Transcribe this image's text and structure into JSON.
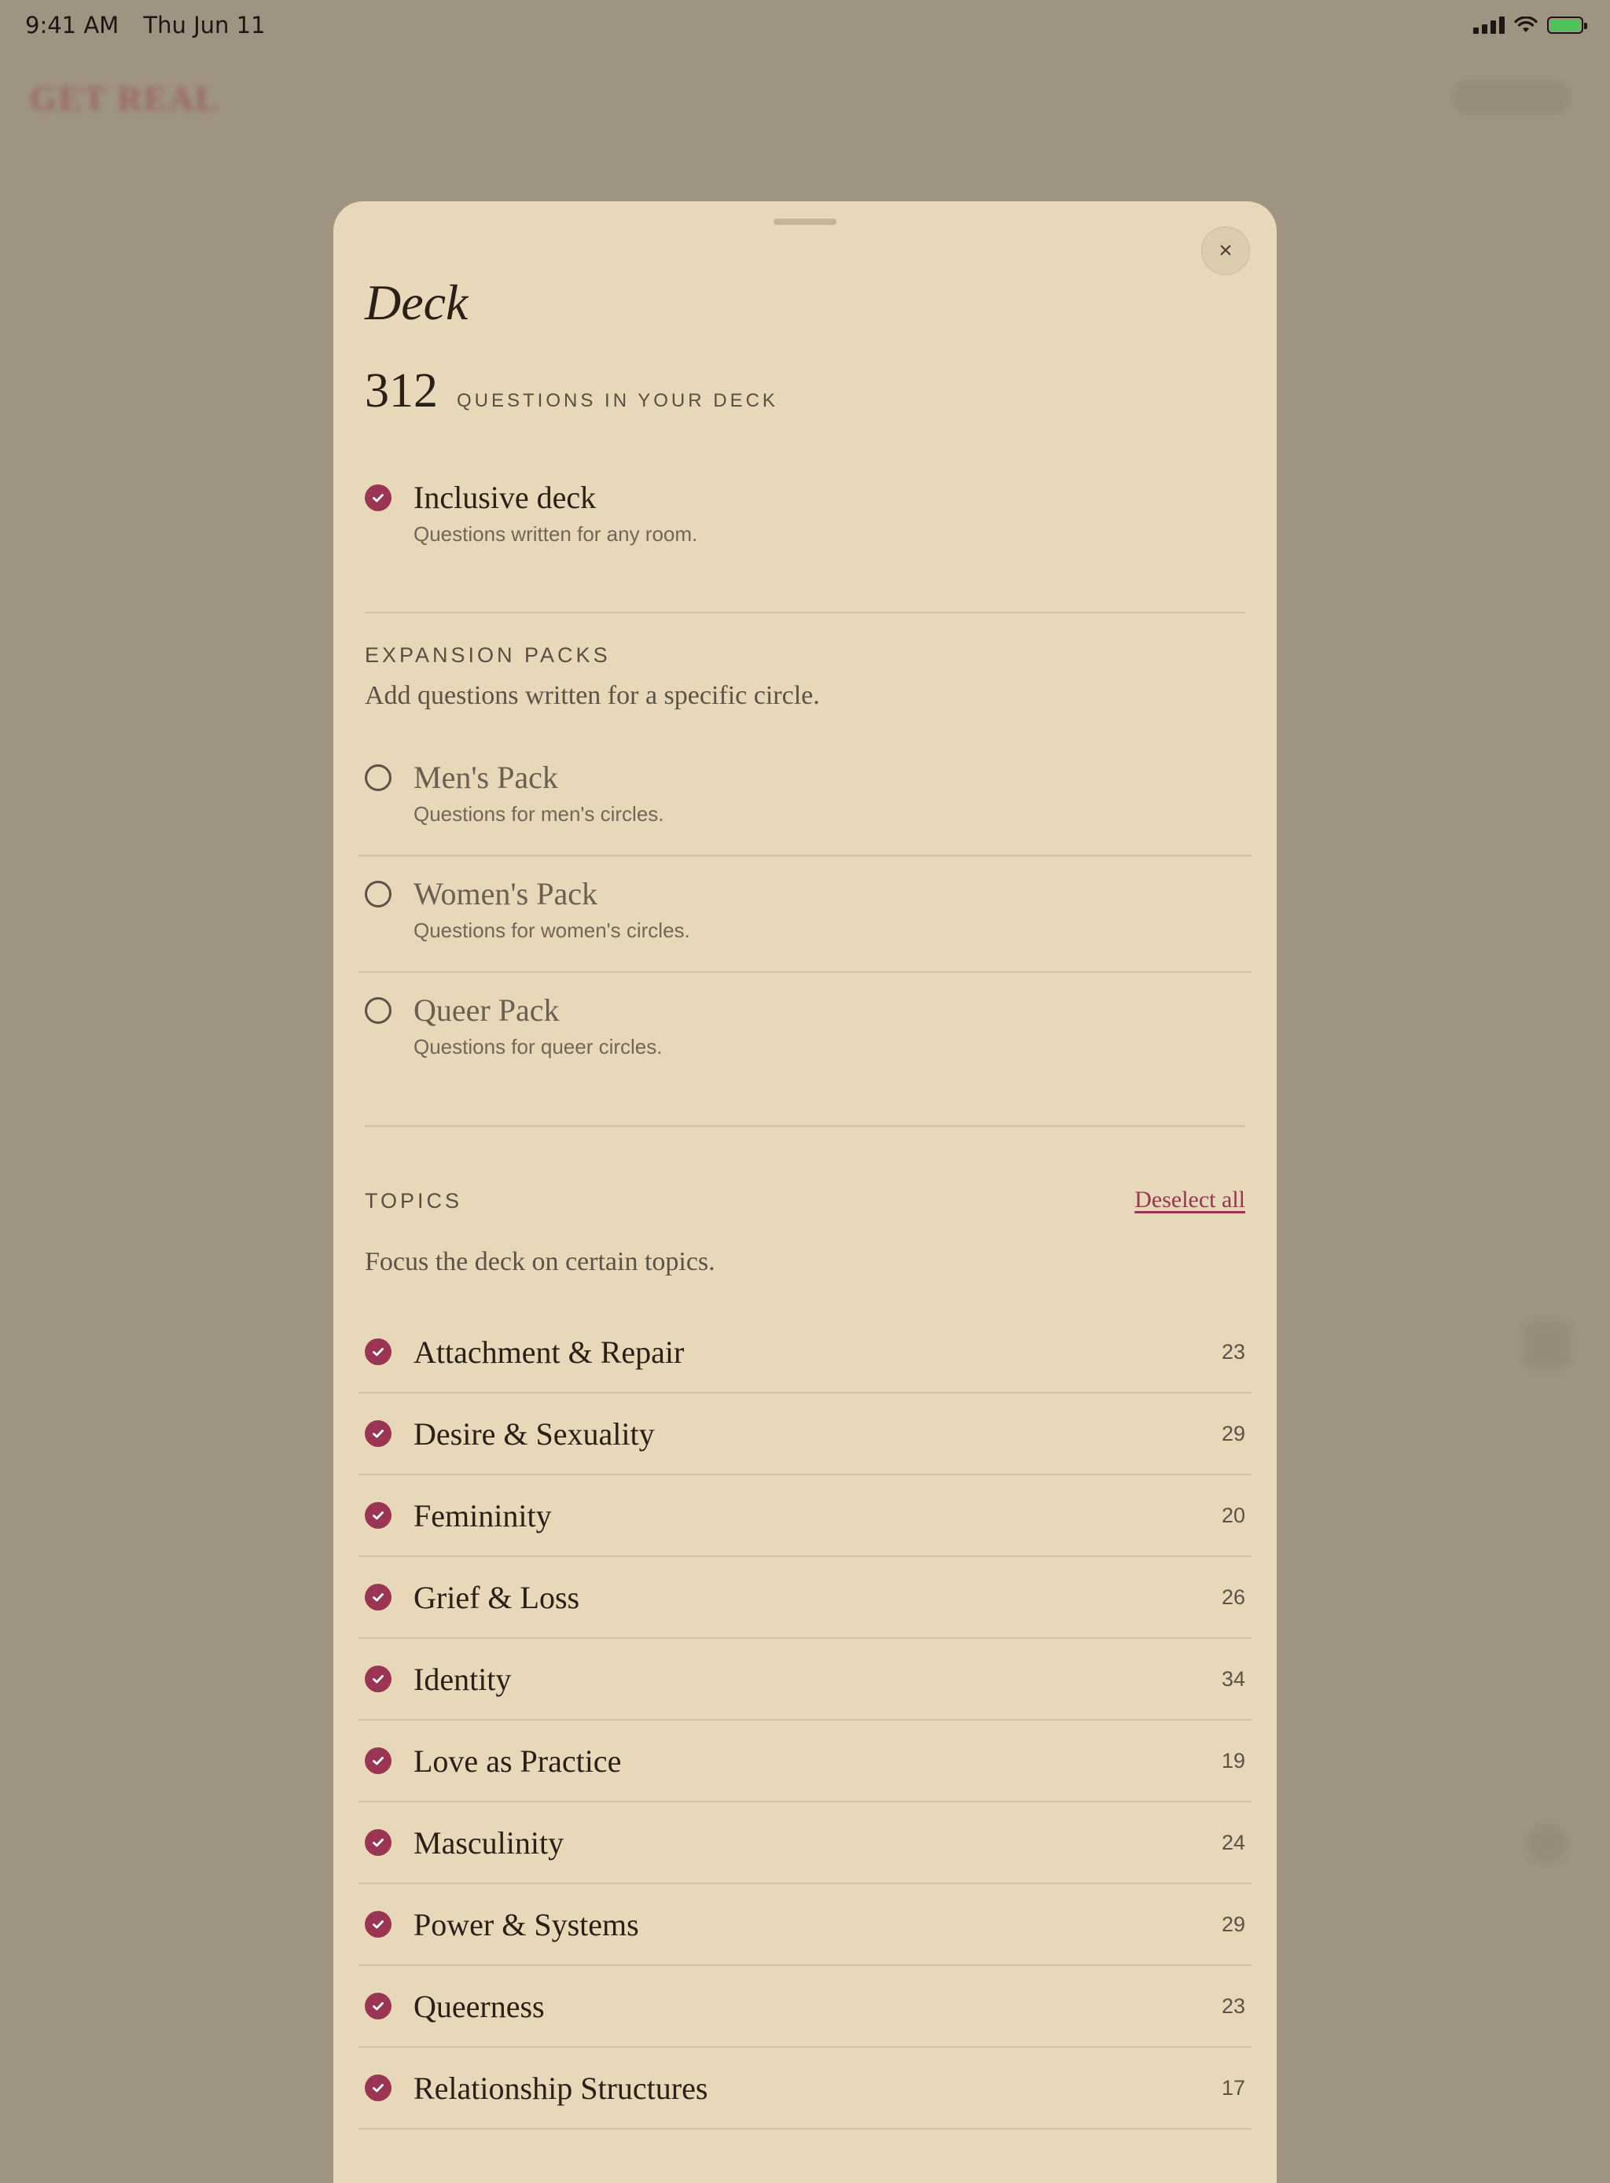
{
  "status_bar": {
    "time": "9:41 AM",
    "date": "Thu Jun 11"
  },
  "background": {
    "logo": "GET REAL"
  },
  "sheet": {
    "title": "Deck",
    "question_count": "312",
    "question_count_label": "QUESTIONS IN YOUR DECK",
    "close_glyph": "×",
    "base_deck": {
      "title": "Inclusive deck",
      "description": "Questions written for any room.",
      "selected": true
    },
    "expansion": {
      "label": "EXPANSION PACKS",
      "subtitle": "Add questions written for a specific circle.",
      "packs": [
        {
          "title": "Men's Pack",
          "description": "Questions for men's circles.",
          "selected": false
        },
        {
          "title": "Women's Pack",
          "description": "Questions for women's circles.",
          "selected": false
        },
        {
          "title": "Queer Pack",
          "description": "Questions for queer circles.",
          "selected": false
        }
      ]
    },
    "topics": {
      "label": "TOPICS",
      "deselect_label": "Deselect all",
      "subtitle": "Focus the deck on certain topics.",
      "items": [
        {
          "name": "Attachment & Repair",
          "count": "23",
          "selected": true
        },
        {
          "name": "Desire & Sexuality",
          "count": "29",
          "selected": true
        },
        {
          "name": "Femininity",
          "count": "20",
          "selected": true
        },
        {
          "name": "Grief & Loss",
          "count": "26",
          "selected": true
        },
        {
          "name": "Identity",
          "count": "34",
          "selected": true
        },
        {
          "name": "Love as Practice",
          "count": "19",
          "selected": true
        },
        {
          "name": "Masculinity",
          "count": "24",
          "selected": true
        },
        {
          "name": "Power & Systems",
          "count": "29",
          "selected": true
        },
        {
          "name": "Queerness",
          "count": "23",
          "selected": true
        },
        {
          "name": "Relationship Structures",
          "count": "17",
          "selected": true
        }
      ]
    }
  },
  "colors": {
    "accent": "#9a3553",
    "sheet_bg": "#e6d8b9",
    "backdrop": "#9f9482"
  }
}
